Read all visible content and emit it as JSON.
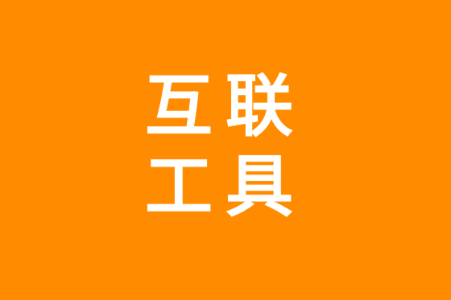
{
  "colors": {
    "background": "#FF8C00",
    "text": "#FFFFFF"
  },
  "title": {
    "line1": "互联",
    "line2": "工具"
  }
}
